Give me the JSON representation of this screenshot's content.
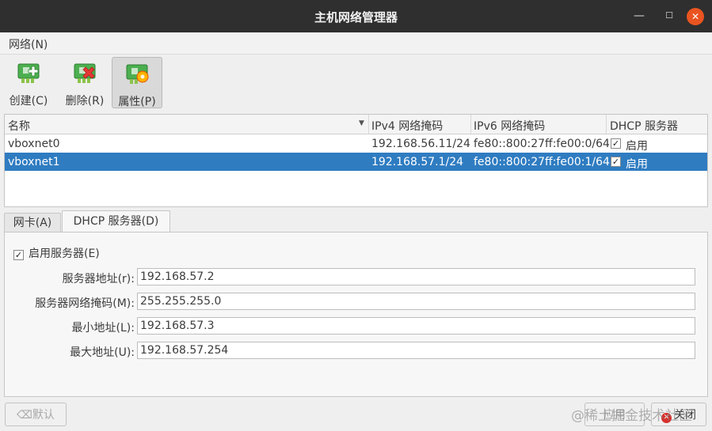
{
  "window": {
    "title": "主机网络管理器",
    "minimize": "—",
    "maximize": "☐",
    "close": "✕"
  },
  "menu": {
    "network": "网络(N)"
  },
  "toolbar": {
    "create": "创建(C)",
    "remove": "删除(R)",
    "properties": "属性(P)"
  },
  "table": {
    "headers": [
      "名称",
      "IPv4 网络掩码",
      "IPv6 网络掩码",
      "DHCP 服务器"
    ],
    "rows": [
      {
        "name": "vboxnet0",
        "ipv4": "192.168.56.11/24",
        "ipv6": "fe80::800:27ff:fe00:0/64",
        "dhcp_checked": "✓",
        "dhcp": "启用"
      },
      {
        "name": "vboxnet1",
        "ipv4": "192.168.57.1/24",
        "ipv6": "fe80::800:27ff:fe00:1/64",
        "dhcp_checked": "✓",
        "dhcp": "启用"
      }
    ],
    "selected_row": "vboxnet1"
  },
  "tabs": {
    "nic": "网卡(A)",
    "dhcp": "DHCP 服务器(D)"
  },
  "dhcp": {
    "enable_checked": "✓",
    "enable_label": "启用服务器(E)",
    "fields": [
      {
        "label": "服务器地址(r):",
        "value": "192.168.57.2"
      },
      {
        "label": "服务器网络掩码(M):",
        "value": "255.255.255.0"
      },
      {
        "label": "最小地址(L):",
        "value": "192.168.57.3"
      },
      {
        "label": "最大地址(U):",
        "value": "192.168.57.254"
      }
    ]
  },
  "buttons": {
    "reset": "默认",
    "apply": "应用",
    "close": "关闭"
  },
  "watermark": "@稀土掘金技术社区",
  "colors": {
    "titlebar": "#2f2f2f",
    "close_button": "#e95420",
    "selection": "#2f7cc1",
    "nic_icon_green": "#5cb85c",
    "remove_red": "#d9302c"
  }
}
